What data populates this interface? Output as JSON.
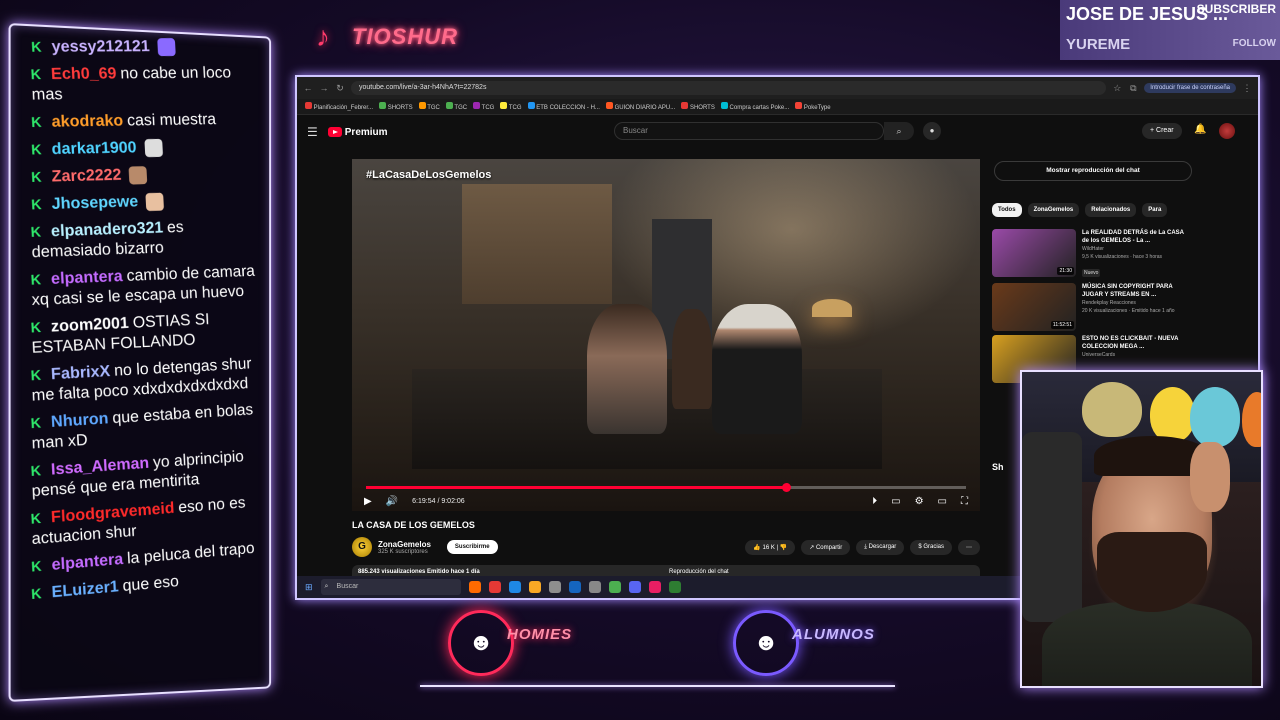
{
  "overlay": {
    "brand_name": "TIOSHUR",
    "subscriber": {
      "name": "JOSE DE JESUS ...",
      "label": "SUBSCRIBER"
    },
    "follow": {
      "name": "YUREME",
      "label": "FOLLOW"
    },
    "logos": [
      {
        "text": "HOMIES",
        "color": "#ff2a5a"
      },
      {
        "text": "ALUMNOS",
        "color": "#7a5aff"
      }
    ]
  },
  "chat": {
    "messages": [
      {
        "user": "yessy212121",
        "text": "",
        "color": "#c9b3ff",
        "emote_color": "#8a6aff"
      },
      {
        "user": "Ech0_69",
        "text": "no cabe un loco mas",
        "color": "#ff3b3b"
      },
      {
        "user": "akodrako",
        "text": "casi muestra",
        "color": "#ff9d2a"
      },
      {
        "user": "darkar1900",
        "text": "",
        "color": "#4fd3ff",
        "emote_color": "#dddddd"
      },
      {
        "user": "Zarc2222",
        "text": "",
        "color": "#ff6b6b",
        "emote_color": "#b88a6a"
      },
      {
        "user": "Jhosepewe",
        "text": "",
        "color": "#5fd6ff",
        "emote_color": "#e8c0a0"
      },
      {
        "user": "elpanadero321",
        "text": "es demasiado bizarro",
        "color": "#b8f0ff"
      },
      {
        "user": "elpantera",
        "text": "cambio de camara xq casi se le escapa un huevo",
        "color": "#c46bff"
      },
      {
        "user": "zoom2001",
        "text": "OSTIAS SI ESTABAN FOLLANDO",
        "color": "#ffffff"
      },
      {
        "user": "FabrixX",
        "text": "no lo detengas shur me falta poco xdxdxdxdxdxdxd",
        "color": "#a9b8ff"
      },
      {
        "user": "Nhuron",
        "text": "que estaba en bolas man xD",
        "color": "#5fa8ff"
      },
      {
        "user": "Issa_Aleman",
        "text": "yo alprincipio pensé que era mentirita",
        "color": "#d06bff"
      },
      {
        "user": "Floodgravemeid",
        "text": "eso no es actuacion shur",
        "color": "#ff2a2a"
      },
      {
        "user": "elpantera",
        "text": "la peluca del trapo",
        "color": "#c46bff"
      },
      {
        "user": "ELuizer1",
        "text": "que eso",
        "color": "#6ab0ff"
      }
    ]
  },
  "browser": {
    "url": "youtube.com/live/a-3ar-h4NhA?t=22782s",
    "password_prompt": "Introducir frase de contraseña",
    "bookmarks": [
      "Planificación_Febrer...",
      "SHORTS",
      "TGC",
      "TGC",
      "TCG",
      "TCG",
      "ETB COLECCION - H...",
      "GUION DIARIO APU...",
      "SHORTS",
      "Compra cartas Poke...",
      "PokeType"
    ],
    "youtube": {
      "logo_text": "Premium",
      "search_placeholder": "Buscar",
      "create_label": "Crear",
      "video": {
        "overlay_title": "#LaCasaDeLosGemelos",
        "title": "LA CASA DE LOS GEMELOS",
        "time_current": "6:19:54",
        "time_total": "9:02:06",
        "time_display": "6:19:54 / 9:02:06",
        "progress": 0.7,
        "channel": "ZonaGemelos",
        "channel_subs": "325 K suscriptores",
        "subscribe_label": "Suscribirme",
        "likes": "16 K",
        "share_label": "Compartir",
        "download_label": "Descargar",
        "thanks_label": "Gracias",
        "views_line": "885.243 visualizaciones  Emitido hace 1 día",
        "chat_replay_label": "Reproducción del chat"
      },
      "sidebar": {
        "show_chat_button": "Mostrar reproducción del chat",
        "chips": [
          "Todos",
          "ZonaGemelos",
          "Relacionados",
          "Para"
        ],
        "recommendations": [
          {
            "title": "La REALIDAD DETRÁS de La CASA de los GEMELOS - La ...",
            "channel": "WildHater",
            "meta": "9,5 K visualizaciones · hace 3 horas",
            "badge": "Nuevo",
            "duration": "21:30",
            "thumb_color": "#9a4aa8"
          },
          {
            "title": "MÚSICA SIN COPYRIGHT PARA JUGAR Y STREAMS EN ...",
            "channel": "Rendekplay Reacciones",
            "meta": "20 K visualizaciones · Emitido hace 1 año",
            "badge": "",
            "duration": "11:52:51",
            "thumb_color": "#6a3a1a"
          },
          {
            "title": "ESTO NO ES CLICKBAIT - NUEVA COLECCION MEGA ...",
            "channel": "UniverseCards",
            "meta": "",
            "badge": "",
            "duration": "",
            "thumb_color": "#d8a020"
          }
        ],
        "shorts_label": "Sh"
      }
    },
    "taskbar": {
      "search_placeholder": "Buscar"
    }
  }
}
